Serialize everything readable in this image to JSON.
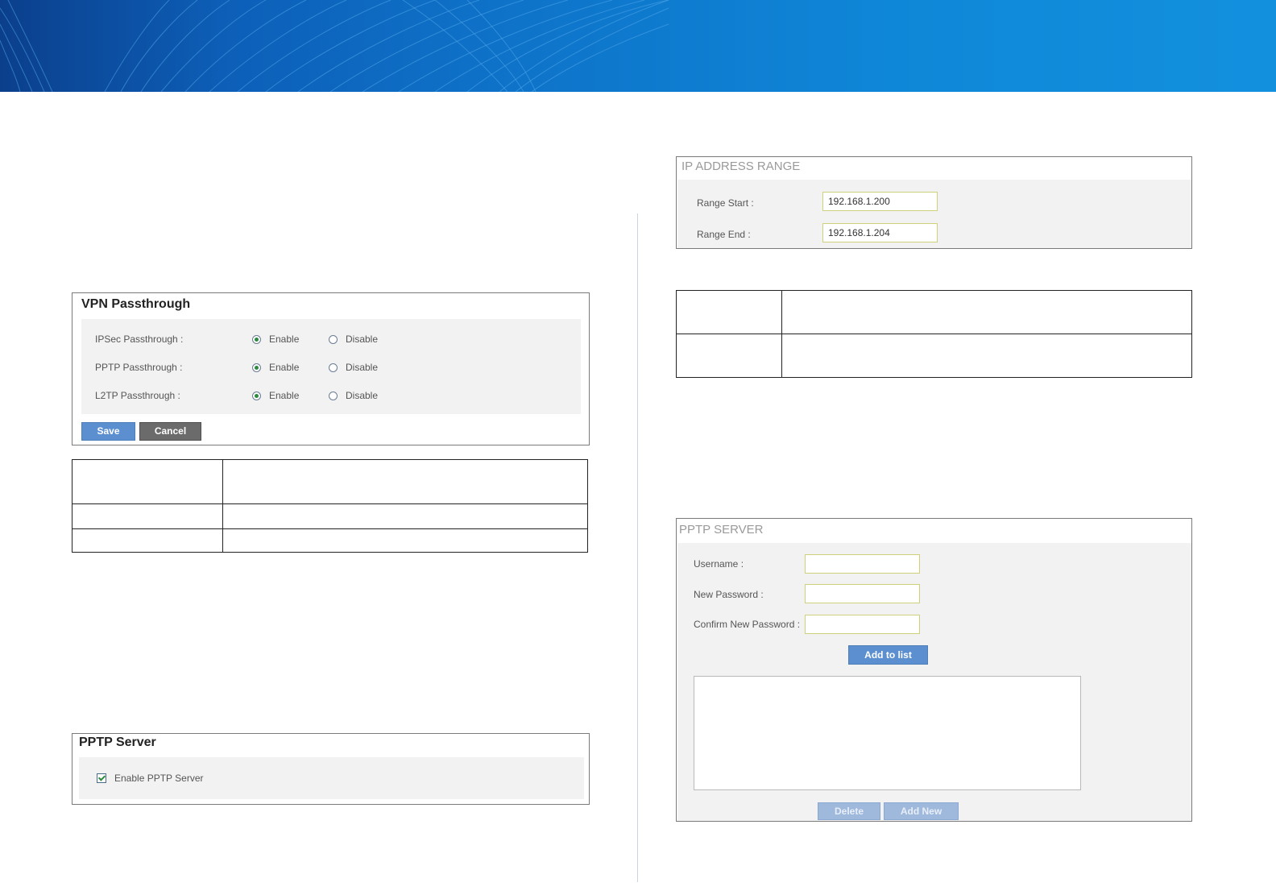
{
  "vpn_passthrough": {
    "title": "VPN Passthrough",
    "rows": [
      {
        "label": "IPSec Passthrough :",
        "enable": "Enable",
        "disable": "Disable",
        "selected": "enable"
      },
      {
        "label": "PPTP Passthrough :",
        "enable": "Enable",
        "disable": "Disable",
        "selected": "enable"
      },
      {
        "label": "L2TP Passthrough :",
        "enable": "Enable",
        "disable": "Disable",
        "selected": "enable"
      }
    ],
    "save_label": "Save",
    "cancel_label": "Cancel"
  },
  "pptp_server_toggle": {
    "title": "PPTP Server",
    "enable_label": "Enable PPTP Server",
    "checked": true
  },
  "ip_range": {
    "title": "IP ADDRESS RANGE",
    "start_label": "Range Start :",
    "start_value": "192.168.1.200",
    "end_label": "Range End :",
    "end_value": "192.168.1.204"
  },
  "pptp_server": {
    "title": "PPTP SERVER",
    "username_label": "Username :",
    "new_password_label": "New Password :",
    "confirm_password_label": "Confirm New Password :",
    "add_to_list_label": "Add to list",
    "delete_label": "Delete",
    "add_new_label": "Add New"
  },
  "colors": {
    "banner_dark": "#0b3f8c",
    "banner_light": "#1290de",
    "button_blue": "#5b8fd0",
    "button_gray": "#6b6b6b",
    "radio_selected": "#2c8a3e"
  }
}
